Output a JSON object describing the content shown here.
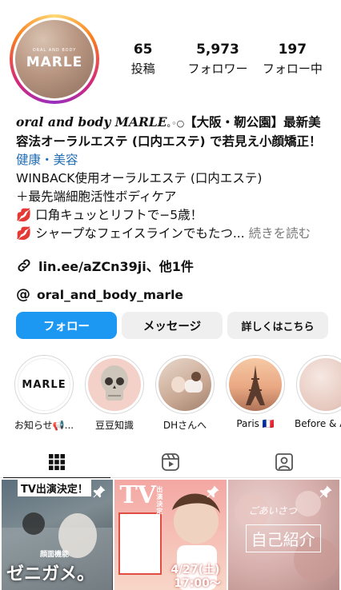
{
  "profile": {
    "avatar_text": "MARLE",
    "avatar_subtext": "ORAL AND BODY"
  },
  "stats": [
    {
      "value": "65",
      "label": "投稿"
    },
    {
      "value": "5,973",
      "label": "フォロワー"
    },
    {
      "value": "197",
      "label": "フォロー中"
    }
  ],
  "bio": {
    "name_latin": "oral and body MARLE",
    "name_deco": "｡◦○",
    "name_rest": "【大阪・靭公園】最新美容法オーラルエステ (口内エステ) で若見え小顔矯正！",
    "category": "健康・美容",
    "line1": "WINBACK使用オーラルエステ (口内エステ)",
    "line2": "＋最先端細胞活性ボディケア",
    "line3": "口角キュッとリフトで−5歳！",
    "line4": "シャープなフェイスラインでもたつ...",
    "more": "続きを読む",
    "lip_emoji": "💋"
  },
  "link": {
    "text": "lin.ee/aZCn39ji、他1件"
  },
  "threads": {
    "handle": "oral_and_body_marle",
    "icon": "@"
  },
  "buttons": {
    "follow": "フォロー",
    "message": "メッセージ",
    "details": "詳しくはこちら"
  },
  "highlights": [
    {
      "label": "お知らせ📢...",
      "image_text": "MARLE"
    },
    {
      "label": "豆豆知識"
    },
    {
      "label": "DHさんへ"
    },
    {
      "label": "Paris 🇫🇷"
    },
    {
      "label": "Before & A"
    }
  ],
  "tabs": [
    {
      "icon": "grid-icon"
    },
    {
      "icon": "reels-icon"
    },
    {
      "icon": "tagged-icon"
    }
  ],
  "posts": [
    {
      "top_text": "TV出演決定！",
      "bottom_small": "顔面機能",
      "bottom_text": "ゼニガメ。"
    },
    {
      "top_text": "TV",
      "top_small": "出演決定",
      "date_text": "4/27(土)",
      "time_text": "17:00〜"
    },
    {
      "top_text": "ごあいさつ",
      "center_text": "自己紹介"
    }
  ]
}
